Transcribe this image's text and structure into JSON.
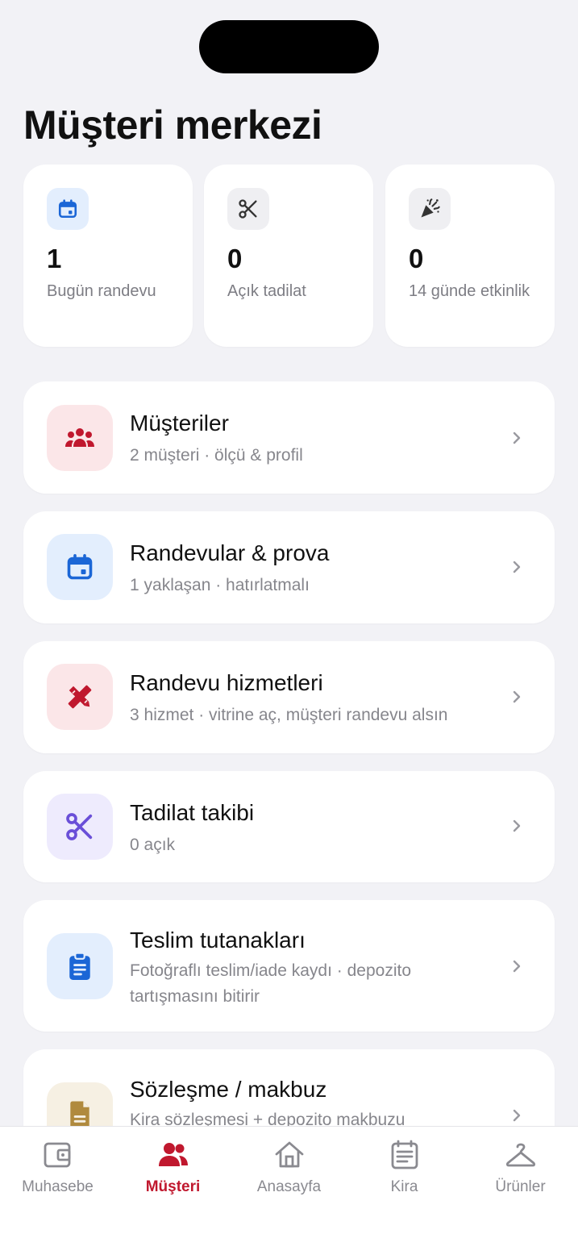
{
  "page": {
    "title": "Müşteri merkezi"
  },
  "stats": [
    {
      "value": "1",
      "label": "Bugün randevu",
      "icon": "calendar-icon",
      "icon_color": "#1b66d6",
      "icon_bg": "#e3eefd"
    },
    {
      "value": "0",
      "label": "Açık tadilat",
      "icon": "scissors-icon",
      "icon_color": "#333333",
      "icon_bg": "#efeff2"
    },
    {
      "value": "0",
      "label": "14 günde etkinlik",
      "icon": "party-popper-icon",
      "icon_color": "#333333",
      "icon_bg": "#efeff2"
    }
  ],
  "menu": [
    {
      "title": "Müşteriler",
      "subtitle": "2 müşteri · ölçü & profil",
      "icon": "users-icon",
      "icon_color": "#c0182e",
      "icon_bg": "#fbe6e8"
    },
    {
      "title": "Randevular & prova",
      "subtitle": "1 yaklaşan · hatırlatmalı",
      "icon": "calendar-icon",
      "icon_color": "#1b66d6",
      "icon_bg": "#e3eefd"
    },
    {
      "title": "Randevu hizmetleri",
      "subtitle": "3 hizmet · vitrine aç, müşteri randevu alsın",
      "icon": "design-tools-icon",
      "icon_color": "#c0182e",
      "icon_bg": "#fbe6e8"
    },
    {
      "title": "Tadilat takibi",
      "subtitle": "0 açık",
      "icon": "scissors-icon",
      "icon_color": "#6a4fd8",
      "icon_bg": "#eeebfd"
    },
    {
      "title": "Teslim tutanakları",
      "subtitle": "Fotoğraflı teslim/iade kaydı · depozito tartışmasını bitirir",
      "icon": "clipboard-icon",
      "icon_color": "#1b66d6",
      "icon_bg": "#e3eefd"
    },
    {
      "title": "Sözleşme / makbuz",
      "subtitle": "Kira sözleşmesi + depozito makbuzu",
      "icon": "document-icon",
      "icon_color": "#b08a3e",
      "icon_bg": "#f6f0e3"
    }
  ],
  "tabbar": {
    "active_color": "#c0182e",
    "inactive_color": "#8a8a90",
    "tabs": [
      {
        "label": "Muhasebe",
        "icon": "wallet-icon",
        "active": false
      },
      {
        "label": "Müşteri",
        "icon": "users-icon",
        "active": true
      },
      {
        "label": "Anasayfa",
        "icon": "home-icon",
        "active": false
      },
      {
        "label": "Kira",
        "icon": "list-document-icon",
        "active": false
      },
      {
        "label": "Ürünler",
        "icon": "hanger-icon",
        "active": false
      }
    ]
  }
}
